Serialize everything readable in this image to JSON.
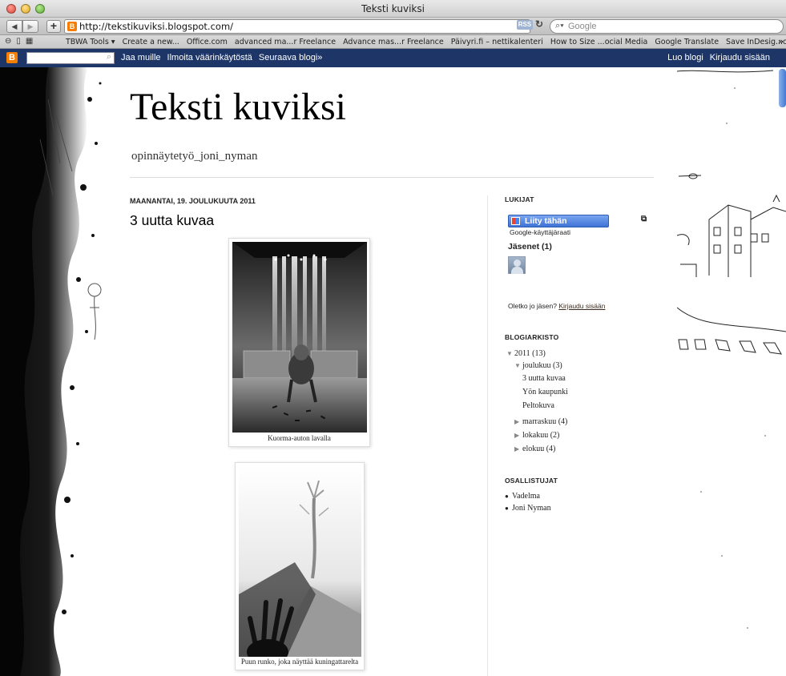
{
  "window": {
    "title": "Teksti kuviksi"
  },
  "browser": {
    "url": "http://tekstikuviksi.blogspot.com/",
    "rss_label": "RSS",
    "search_placeholder": "Google",
    "bookmarks": [
      "TBWA Tools ▾",
      "Create a new...",
      "Office.com",
      "advanced ma...r Freelance",
      "Advance mas...r Freelance",
      "Päivyri.fi – nettikalenteri",
      "How to Size ...ocial Media",
      "Google Translate",
      "Save InDesig...of InDesign"
    ]
  },
  "navbar": {
    "left_links": [
      "Jaa muille",
      "Ilmoita väärinkäytöstä",
      "Seuraava blogi»"
    ],
    "right_links": [
      "Luo blogi",
      "Kirjaudu sisään"
    ]
  },
  "blog": {
    "title": "Teksti kuviksi",
    "description": "opinnäytetyö_joni_nyman"
  },
  "post": {
    "date": "MAANANTAI, 19. JOULUKUUTA 2011",
    "title": "3 uutta kuvaa",
    "images": [
      {
        "caption": "Kuorma-auton lavalla"
      },
      {
        "caption": "Puun runko, joka näyttää kuningattarelta"
      }
    ]
  },
  "sidebar": {
    "followers": {
      "title": "LUKIJAT",
      "join_label": "Liity tähän sivustoon",
      "gfc_label": "Google-käyttäjäraati",
      "members_label": "Jäsenet (1)",
      "already_member": "Oletko jo jäsen?",
      "sign_in": "Kirjaudu sisään"
    },
    "archive": {
      "title": "BLOGIARKISTO",
      "year": "2011 (13)",
      "open_month": "joulukuu (3)",
      "posts": [
        "3 uutta kuvaa",
        "Yön kaupunki",
        "Peltokuva"
      ],
      "other_months": [
        "marraskuu (4)",
        "lokakuu (2)",
        "elokuu (4)"
      ]
    },
    "contributors": {
      "title": "OSALLISTUJAT",
      "names": [
        "Vadelma",
        "Joni Nyman"
      ]
    }
  }
}
